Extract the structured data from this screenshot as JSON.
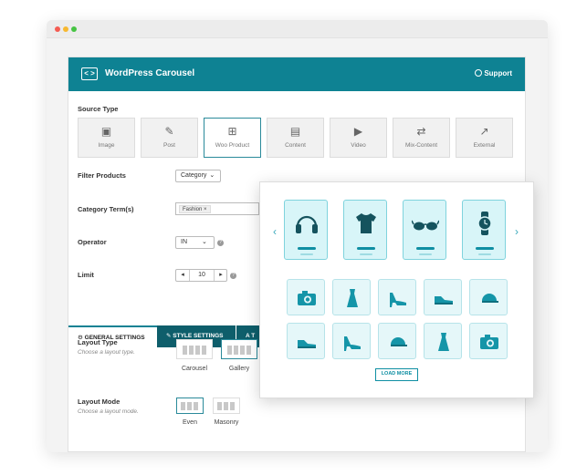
{
  "header": {
    "title": "WordPress Carousel",
    "support": "Support",
    "logo_text": "< >"
  },
  "source": {
    "label": "Source Type",
    "items": [
      {
        "label": "Image",
        "icon": "image-icon",
        "glyph": "▣"
      },
      {
        "label": "Post",
        "icon": "pin-icon",
        "glyph": "✎"
      },
      {
        "label": "Woo Product",
        "icon": "cart-icon",
        "glyph": "⊞"
      },
      {
        "label": "Content",
        "icon": "document-icon",
        "glyph": "▤"
      },
      {
        "label": "Video",
        "icon": "play-icon",
        "glyph": "▶"
      },
      {
        "label": "Mix-Content",
        "icon": "shuffle-icon",
        "glyph": "⇄"
      },
      {
        "label": "External",
        "icon": "external-link-icon",
        "glyph": "↗"
      }
    ]
  },
  "fields": {
    "filter_products": {
      "label": "Filter Products",
      "value": "Category"
    },
    "category_terms": {
      "label": "Category Term(s)",
      "tag": "Fashion",
      "tag_remove": "×"
    },
    "operator": {
      "label": "Operator",
      "value": "IN"
    },
    "limit": {
      "label": "Limit",
      "value": "10",
      "dec": "◂",
      "inc": "▸"
    },
    "help_glyph": "?"
  },
  "tabs": {
    "general": "GENERAL SETTINGS",
    "style": "STYLE SETTINGS",
    "third": "T"
  },
  "layout_type": {
    "label": "Layout Type",
    "hint": "Choose a layout type.",
    "options": [
      "Carousel",
      "Gallery"
    ]
  },
  "layout_mode": {
    "label": "Layout Mode",
    "hint": "Choose a layout mode.",
    "options": [
      "Even",
      "Masonry"
    ]
  },
  "popup": {
    "prev": "‹",
    "next": "›",
    "load_more": "LOAD MORE",
    "featured": [
      "headphones-icon",
      "tshirt-icon",
      "sunglasses-icon",
      "watch-icon"
    ],
    "grid": [
      "camera-icon",
      "dress-icon",
      "heel-icon",
      "sneaker-icon",
      "cap-icon",
      "sneaker-icon",
      "heel-icon",
      "cap-icon",
      "dress-icon",
      "camera-icon"
    ]
  },
  "colors": {
    "teal": "#0e8293",
    "accent": "#0f8fa3",
    "light": "#d8f5f8"
  }
}
